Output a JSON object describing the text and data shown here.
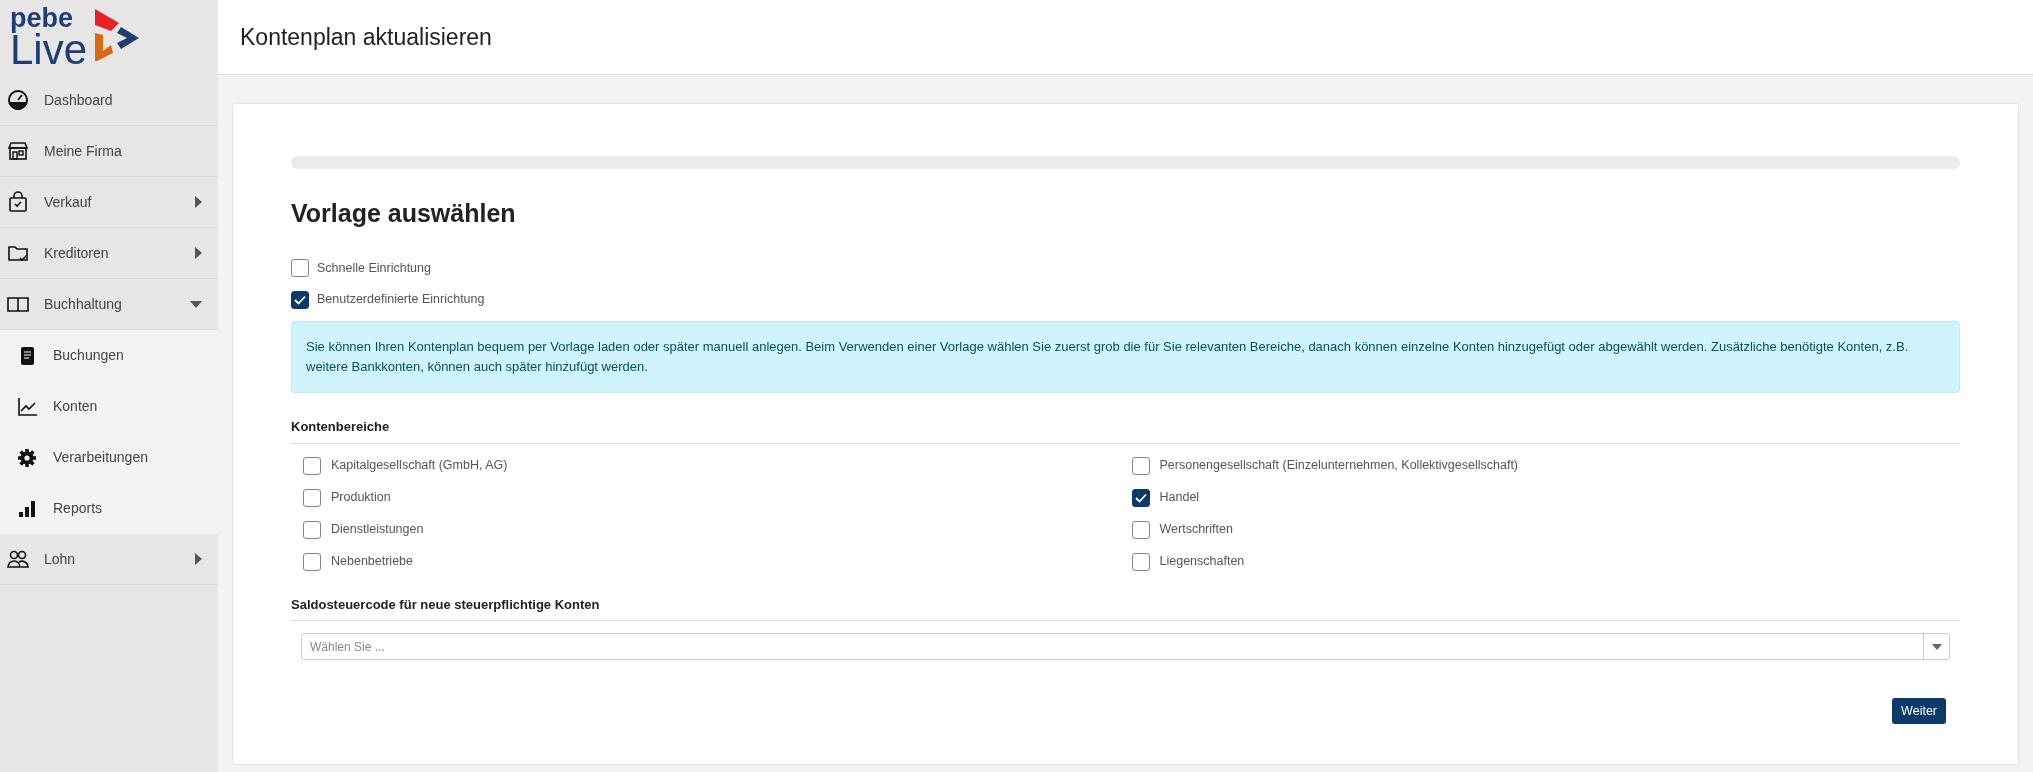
{
  "logo": {
    "line1": "pebe",
    "line2": "Live"
  },
  "sidebar": {
    "items": [
      {
        "label": "Dashboard"
      },
      {
        "label": "Meine Firma"
      },
      {
        "label": "Verkauf",
        "expanded": false
      },
      {
        "label": "Kreditoren",
        "expanded": false
      },
      {
        "label": "Buchhaltung",
        "expanded": true,
        "children": [
          {
            "label": "Buchungen"
          },
          {
            "label": "Konten"
          },
          {
            "label": "Verarbeitungen"
          },
          {
            "label": "Reports"
          }
        ]
      },
      {
        "label": "Lohn",
        "expanded": false
      }
    ]
  },
  "header": {
    "title": "Kontenplan aktualisieren"
  },
  "progress": {
    "level": 0
  },
  "section_title": "Vorlage auswählen",
  "setup_options": [
    {
      "label": "Schnelle Einrichtung",
      "checked": false
    },
    {
      "label": "Benutzerdefinierte Einrichtung",
      "checked": true
    }
  ],
  "info": "Sie können Ihren Kontenplan bequem per Vorlage laden oder später manuell anlegen. Beim Verwenden einer Vorlage wählen Sie zuerst grob die für Sie relevanten Bereiche, danach können einzelne Konten hinzugefügt oder abgewählt werden. Zusätzliche benötigte Konten, z.B. weitere Bankkonten, können auch später hinzufügt werden.",
  "areas": {
    "title": "Kontenbereiche",
    "items": [
      {
        "label": "Kapitalgesellschaft (GmbH, AG)",
        "checked": false
      },
      {
        "label": "Personengesellschaft (Einzelunternehmen, Kollektivgesellschaft)",
        "checked": false
      },
      {
        "label": "Produktion",
        "checked": false
      },
      {
        "label": "Handel",
        "checked": true
      },
      {
        "label": "Dienstleistungen",
        "checked": false
      },
      {
        "label": "Wertschriften",
        "checked": false
      },
      {
        "label": "Nebenbetriebe",
        "checked": false
      },
      {
        "label": "Liegenschaften",
        "checked": false
      }
    ]
  },
  "tax_code": {
    "title": "Saldosteuercode für neue steuerpflichtige Konten",
    "placeholder": "Wählen Sie ..."
  },
  "buttons": [
    {
      "label": "Weiter"
    }
  ]
}
